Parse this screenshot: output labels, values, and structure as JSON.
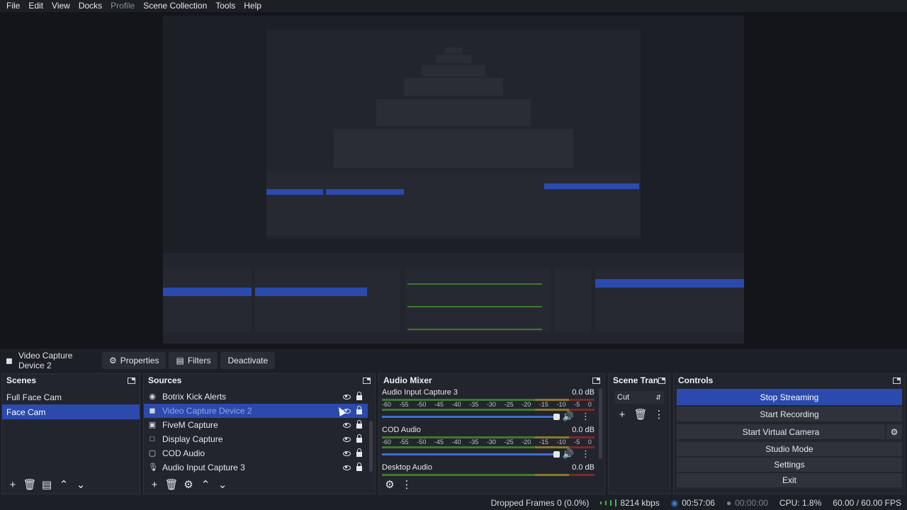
{
  "menu": [
    "File",
    "Edit",
    "View",
    "Docks",
    "Profile",
    "Scene Collection",
    "Tools",
    "Help"
  ],
  "context_bar": {
    "source_name": "Video Capture Device 2",
    "properties": "Properties",
    "filters": "Filters",
    "deactivate": "Deactivate"
  },
  "docks": {
    "scenes": {
      "title": "Scenes",
      "items": [
        "Full Face Cam",
        "Face Cam"
      ],
      "selected": 1
    },
    "sources": {
      "title": "Sources",
      "items": [
        {
          "label": "Botrix Kick Alerts",
          "icon": "browser-icon"
        },
        {
          "label": "Video Capture Device 2",
          "icon": "camera-icon"
        },
        {
          "label": "FiveM Capture",
          "icon": "game-icon"
        },
        {
          "label": "Display Capture",
          "icon": "display-icon"
        },
        {
          "label": "COD Audio",
          "icon": "speaker-icon"
        },
        {
          "label": "Audio Input Capture 3",
          "icon": "microphone-icon"
        }
      ],
      "selected": 1
    },
    "audio_mixer": {
      "title": "Audio Mixer",
      "channels": [
        {
          "name": "Audio Input Capture 3",
          "db": "0.0 dB"
        },
        {
          "name": "COD Audio",
          "db": "0.0 dB"
        },
        {
          "name": "Desktop Audio",
          "db": "0.0 dB"
        }
      ],
      "scale": [
        "-60",
        "-55",
        "-50",
        "-45",
        "-40",
        "-35",
        "-30",
        "-25",
        "-20",
        "-15",
        "-10",
        "-5",
        "0"
      ]
    },
    "transitions": {
      "title": "Scene Tran...",
      "selected": "Cut"
    },
    "controls": {
      "title": "Controls",
      "buttons": [
        "Stop Streaming",
        "Start Recording",
        "Start Virtual Camera",
        "Studio Mode",
        "Settings",
        "Exit"
      ]
    }
  },
  "status": {
    "dropped": "Dropped Frames 0 (0.0%)",
    "bitrate": "8214 kbps",
    "stream_time": "00:57:06",
    "rec_time": "00:00:00",
    "cpu": "CPU: 1.8%",
    "fps": "60.00 / 60.00 FPS"
  }
}
